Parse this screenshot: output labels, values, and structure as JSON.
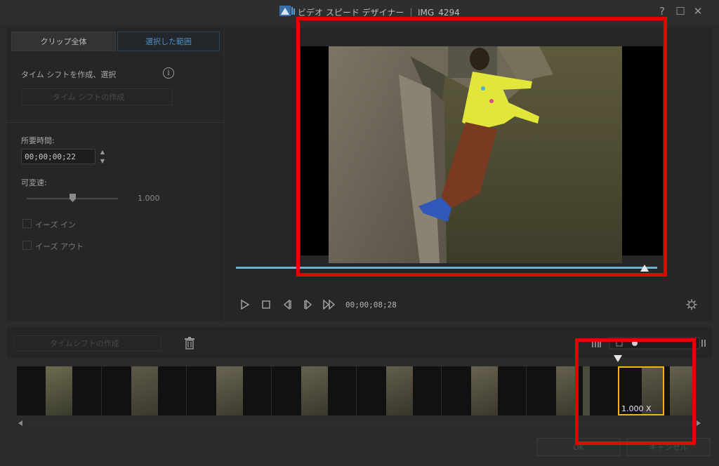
{
  "window": {
    "title": "ビデオ スピード デザイナー ｜ IMG_4294",
    "help": "?",
    "maximize": "☐",
    "close": "✕"
  },
  "tabs": {
    "whole_clip": "クリップ全体",
    "selected_range": "選択した範囲"
  },
  "left": {
    "timeshift_label": "タイム シフトを作成、選択",
    "info": "i",
    "add_timeshift": "タイム シフトの作成",
    "duration_label": "所要時間:",
    "duration_value": "00;00;00;22",
    "variable_speed_label": "可変速:",
    "variable_speed_value": "1.000",
    "variable_speed_level": 0.5,
    "ease_in": "イーズ イン",
    "ease_out": "イーズ アウト"
  },
  "preview": {
    "timecode": "00;00;08;28",
    "progress": 0.97
  },
  "timeline": {
    "add_timeshift": "タイムシフトの作成",
    "speed_label": "1.000 X"
  },
  "footer": {
    "ok": "OK",
    "cancel": "キャンセル"
  },
  "colors": {
    "accent": "#4c8dc9",
    "scrub": "#6bb0d4",
    "highlight": "#e60000",
    "segment": "#f2b318"
  }
}
